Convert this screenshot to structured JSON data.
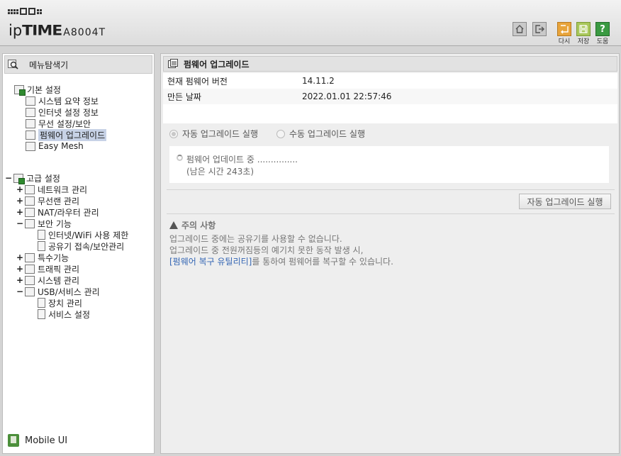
{
  "header": {
    "logo_ip": "ip",
    "logo_time": "TIME",
    "model": "A8004T",
    "buttons": {
      "reload": "다시",
      "save": "저장",
      "help": "도움",
      "help_glyph": "?"
    }
  },
  "left": {
    "title": "메뉴탐색기",
    "basic": {
      "label": "기본 설정",
      "items": [
        "시스템 요약 정보",
        "인터넷 설정 정보",
        "무선 설정/보안",
        "펌웨어 업그레이드",
        "Easy Mesh"
      ]
    },
    "advanced": {
      "toggle": "−",
      "label": "고급 설정",
      "items": [
        {
          "toggle": "+",
          "label": "네트워크 관리"
        },
        {
          "toggle": "+",
          "label": "무선랜 관리"
        },
        {
          "toggle": "+",
          "label": "NAT/라우터 관리"
        },
        {
          "toggle": "−",
          "label": "보안 기능"
        },
        {
          "toggle": "",
          "label": "인터넷/WiFi 사용 제한"
        },
        {
          "toggle": "",
          "label": "공유기 접속/보안관리"
        },
        {
          "toggle": "+",
          "label": "특수기능"
        },
        {
          "toggle": "+",
          "label": "트래픽 관리"
        },
        {
          "toggle": "+",
          "label": "시스템 관리"
        },
        {
          "toggle": "−",
          "label": "USB/서비스 관리"
        },
        {
          "toggle": "",
          "label": "장치 관리"
        },
        {
          "toggle": "",
          "label": "서비스 설정"
        }
      ]
    },
    "mobile": "Mobile UI"
  },
  "main": {
    "title": "펌웨어 업그레이드",
    "current_version_label": "현재 펌웨어 버전",
    "current_version": "14.11.2",
    "build_date_label": "만든 날짜",
    "build_date": "2022.01.01 22:57:46",
    "option_auto": "자동 업그레이드 실행",
    "option_manual": "수동 업그레이드 실행",
    "status_line1": "펌웨어 업데이트 중 ...............",
    "status_line2": "(남은 시간 243초)",
    "run_button": "자동 업그레이드 실행",
    "caution_title": "주의 사항",
    "caution_line1": "업그레이드 중에는 공유기를 사용할 수 없습니다.",
    "caution_line2": "업그레이드 중 전원꺼짐등의 예기치 못한 동작 발생 시,",
    "caution_link": "[펌웨어 복구 유틸리티]",
    "caution_line3_rest": "를 통하여 펌웨어를 복구할 수 있습니다."
  }
}
